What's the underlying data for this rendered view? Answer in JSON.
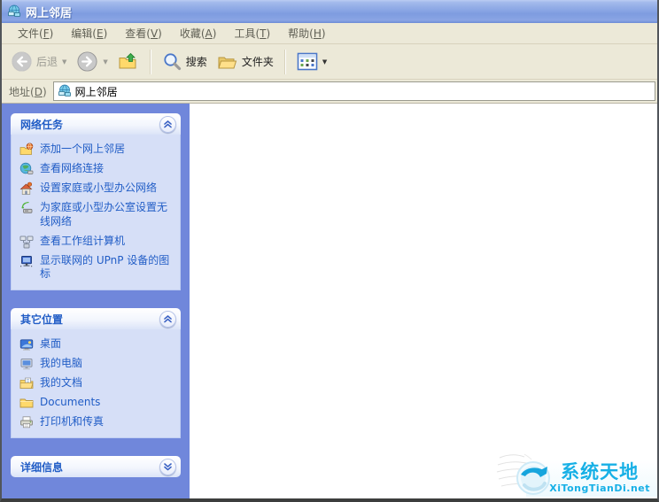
{
  "window": {
    "title": "网上邻居"
  },
  "menu_bar": {
    "items": [
      {
        "label": "文件(F)"
      },
      {
        "label": "编辑(E)"
      },
      {
        "label": "查看(V)"
      },
      {
        "label": "收藏(A)"
      },
      {
        "label": "工具(T)"
      },
      {
        "label": "帮助(H)"
      }
    ]
  },
  "toolbar": {
    "back_label": "后退",
    "search_label": "搜索",
    "folders_label": "文件夹"
  },
  "address_bar": {
    "label": "地址(D)",
    "value": "网上邻居"
  },
  "sidebar": {
    "sections": [
      {
        "id": "network-tasks",
        "title": "网络任务",
        "collapsed": false,
        "items": [
          {
            "icon": "add-network-place-icon",
            "label": "添加一个网上邻居"
          },
          {
            "icon": "network-connections-icon",
            "label": "查看网络连接"
          },
          {
            "icon": "home-network-icon",
            "label": "设置家庭或小型办公网络"
          },
          {
            "icon": "wireless-network-icon",
            "label": "为家庭或小型办公室设置无线网络"
          },
          {
            "icon": "workgroup-computers-icon",
            "label": "查看工作组计算机"
          },
          {
            "icon": "upnp-devices-icon",
            "label": "显示联网的 UPnP 设备的图标"
          }
        ]
      },
      {
        "id": "other-places",
        "title": "其它位置",
        "collapsed": false,
        "items": [
          {
            "icon": "desktop-icon",
            "label": "桌面"
          },
          {
            "icon": "my-computer-icon",
            "label": "我的电脑"
          },
          {
            "icon": "my-documents-icon",
            "label": "我的文档"
          },
          {
            "icon": "folder-icon",
            "label": "Documents"
          },
          {
            "icon": "printer-icon",
            "label": "打印机和传真"
          }
        ]
      },
      {
        "id": "details",
        "title": "详细信息",
        "collapsed": true,
        "items": []
      }
    ]
  },
  "watermark": {
    "name": "系统天地",
    "site": "XiTongTianDi.net"
  },
  "colors": {
    "titlebar_blue": "#7e9ce0",
    "chrome_bg": "#ece9d8",
    "sidebar_bg": "#7087db",
    "panel_bg": "#d6dff7",
    "link_blue": "#215dc6",
    "watermark_cyan": "#17b0e6"
  }
}
